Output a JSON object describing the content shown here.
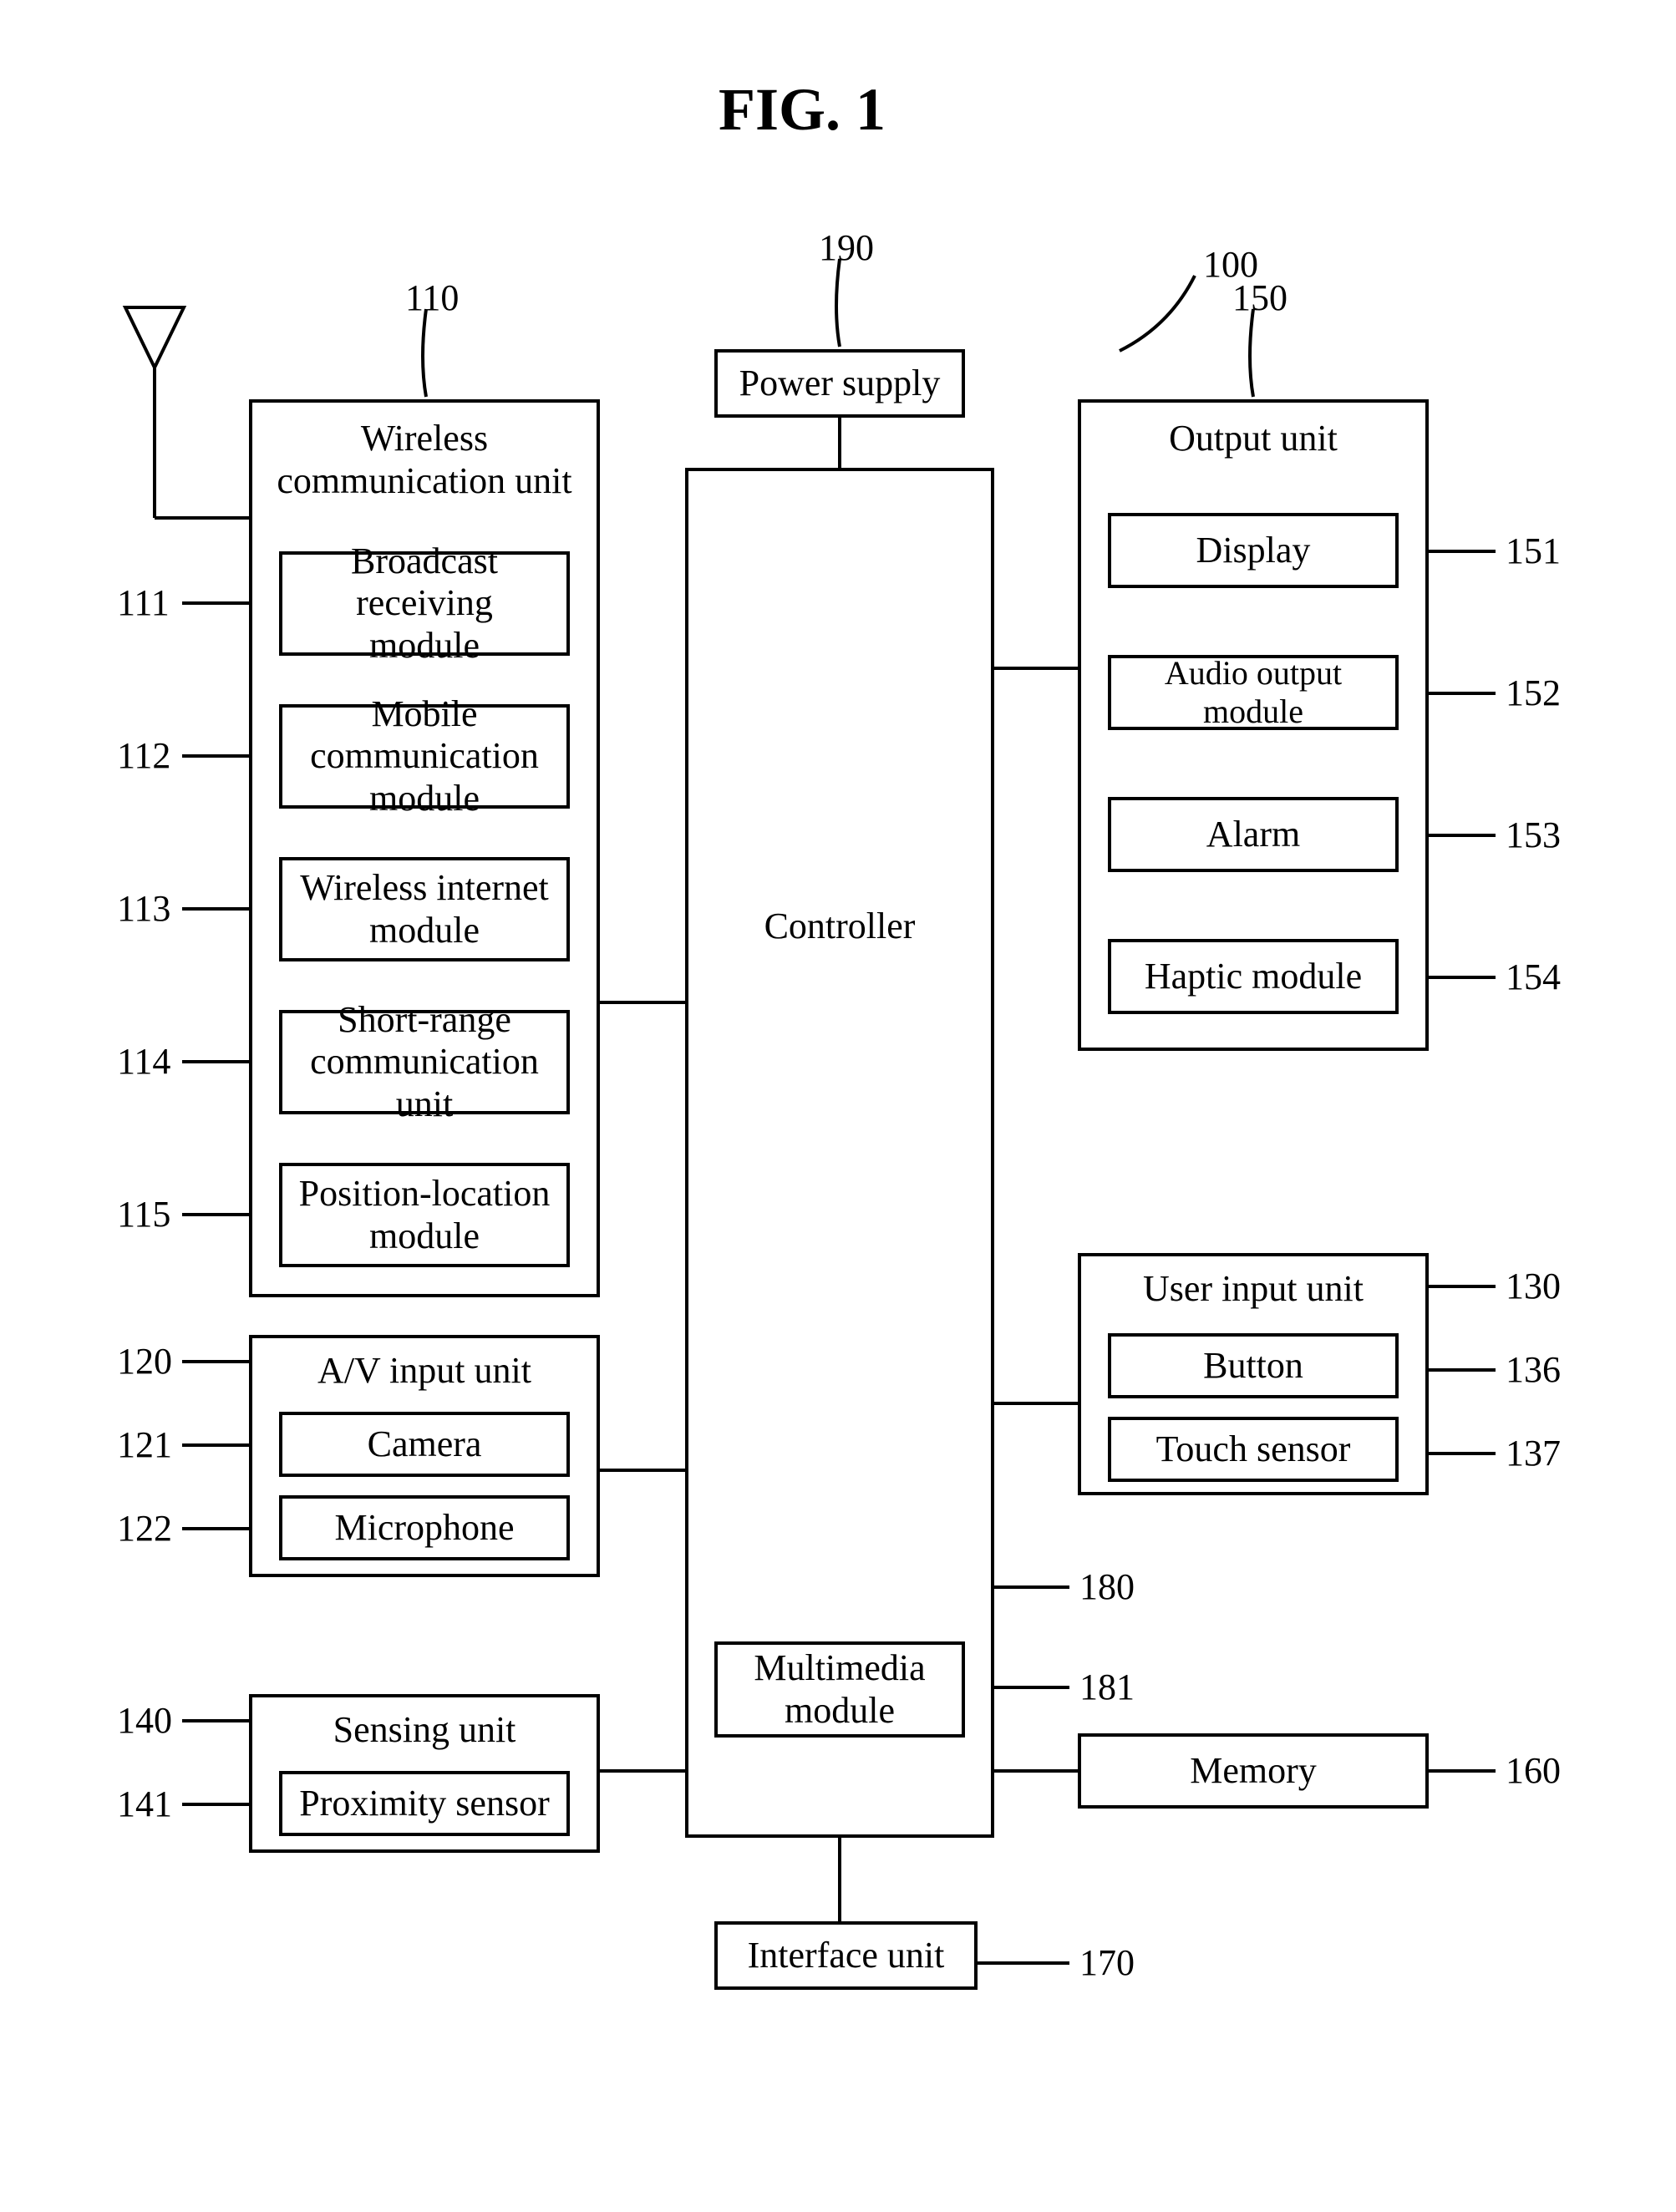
{
  "figure_title": "FIG. 1",
  "refs": {
    "r100": "100",
    "r110": "110",
    "r111": "111",
    "r112": "112",
    "r113": "113",
    "r114": "114",
    "r115": "115",
    "r120": "120",
    "r121": "121",
    "r122": "122",
    "r130": "130",
    "r136": "136",
    "r137": "137",
    "r140": "140",
    "r141": "141",
    "r150": "150",
    "r151": "151",
    "r152": "152",
    "r153": "153",
    "r154": "154",
    "r160": "160",
    "r170": "170",
    "r180": "180",
    "r181": "181",
    "r190": "190"
  },
  "blocks": {
    "power_supply": "Power supply",
    "controller": "Controller",
    "multimedia_module": "Multimedia\nmodule",
    "interface_unit": "Interface unit",
    "memory": "Memory",
    "wireless_comm_unit": {
      "title": "Wireless\ncommunication unit",
      "m111": "Broadcast receiving\nmodule",
      "m112": "Mobile communication\nmodule",
      "m113": "Wireless internet\nmodule",
      "m114": "Short-range\ncommunication unit",
      "m115": "Position-location\nmodule"
    },
    "av_input_unit": {
      "title": "A/V input unit",
      "m121": "Camera",
      "m122": "Microphone"
    },
    "sensing_unit": {
      "title": "Sensing unit",
      "m141": "Proximity sensor"
    },
    "output_unit": {
      "title": "Output unit",
      "m151": "Display",
      "m152": "Audio output module",
      "m153": "Alarm",
      "m154": "Haptic module"
    },
    "user_input_unit": {
      "title": "User input unit",
      "m136": "Button",
      "m137": "Touch sensor"
    }
  },
  "chart_data": {
    "type": "block_diagram",
    "title": "FIG. 1",
    "system_ref": "100",
    "nodes": [
      {
        "id": "190",
        "label": "Power supply"
      },
      {
        "id": "180",
        "label": "Controller",
        "children": [
          {
            "id": "181",
            "label": "Multimedia module"
          }
        ]
      },
      {
        "id": "170",
        "label": "Interface unit"
      },
      {
        "id": "160",
        "label": "Memory"
      },
      {
        "id": "110",
        "label": "Wireless communication unit",
        "children": [
          {
            "id": "111",
            "label": "Broadcast receiving module"
          },
          {
            "id": "112",
            "label": "Mobile communication module"
          },
          {
            "id": "113",
            "label": "Wireless internet module"
          },
          {
            "id": "114",
            "label": "Short-range communication unit"
          },
          {
            "id": "115",
            "label": "Position-location module"
          }
        ]
      },
      {
        "id": "120",
        "label": "A/V input unit",
        "children": [
          {
            "id": "121",
            "label": "Camera"
          },
          {
            "id": "122",
            "label": "Microphone"
          }
        ]
      },
      {
        "id": "140",
        "label": "Sensing unit",
        "children": [
          {
            "id": "141",
            "label": "Proximity sensor"
          }
        ]
      },
      {
        "id": "150",
        "label": "Output unit",
        "children": [
          {
            "id": "151",
            "label": "Display"
          },
          {
            "id": "152",
            "label": "Audio output module"
          },
          {
            "id": "153",
            "label": "Alarm"
          },
          {
            "id": "154",
            "label": "Haptic module"
          }
        ]
      },
      {
        "id": "130",
        "label": "User input unit",
        "children": [
          {
            "id": "136",
            "label": "Button"
          },
          {
            "id": "137",
            "label": "Touch sensor"
          }
        ]
      }
    ],
    "edges": [
      {
        "from": "190",
        "to": "180"
      },
      {
        "from": "110",
        "to": "180"
      },
      {
        "from": "120",
        "to": "180"
      },
      {
        "from": "140",
        "to": "180"
      },
      {
        "from": "150",
        "to": "180"
      },
      {
        "from": "130",
        "to": "180"
      },
      {
        "from": "160",
        "to": "180"
      },
      {
        "from": "170",
        "to": "180"
      },
      {
        "from": "antenna",
        "to": "110"
      }
    ]
  }
}
